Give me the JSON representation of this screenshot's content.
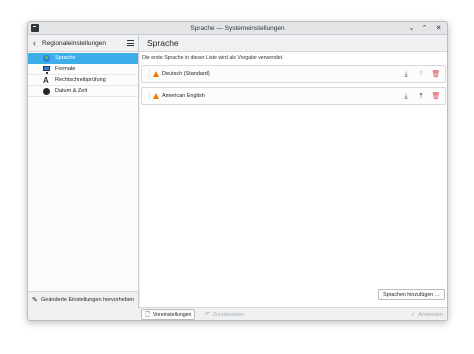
{
  "window": {
    "title": "Sprache — Systemeinstellungen",
    "controls": {
      "minimize": "⌄",
      "maximize": "⌃",
      "close": "✕"
    }
  },
  "sidebar": {
    "back_icon": "‹",
    "title": "Regionaleinstellungen",
    "items": [
      {
        "label": "Sprache",
        "icon": "globe-flag-icon",
        "active": true
      },
      {
        "label": "Formate",
        "icon": "monitor-icon",
        "active": false
      },
      {
        "label": "Rechtschreibprüfung",
        "icon": "spellcheck-icon",
        "active": false
      },
      {
        "label": "Datum & Zeit",
        "icon": "clock-icon",
        "active": false
      }
    ],
    "footer_label": "Geänderte Einstellungen hervorheben",
    "footer_icon": "✎"
  },
  "main": {
    "title": "Sprache",
    "hint": "Die erste Sprache in dieser Liste wird als Vorgabe verwendet.",
    "languages": [
      {
        "label": "Deutsch (Standard)",
        "drag": "⋮",
        "down": "⤓",
        "top": "⤒",
        "remove": "🗑"
      },
      {
        "label": "American English",
        "drag": "⋮",
        "down": "⤓",
        "top": "⤒",
        "remove": "🗑"
      }
    ],
    "add_button": "Sprachen hinzufügen …"
  },
  "bottom_bar": {
    "defaults": "Voreinstellungen",
    "defaults_icon": "🗋",
    "reset": "Zurücksetzen",
    "reset_icon": "↶",
    "apply": "Anwenden",
    "apply_icon": "✓"
  },
  "colors": {
    "accent": "#3daee9",
    "warning": "#f67400",
    "danger": "#da4453"
  }
}
